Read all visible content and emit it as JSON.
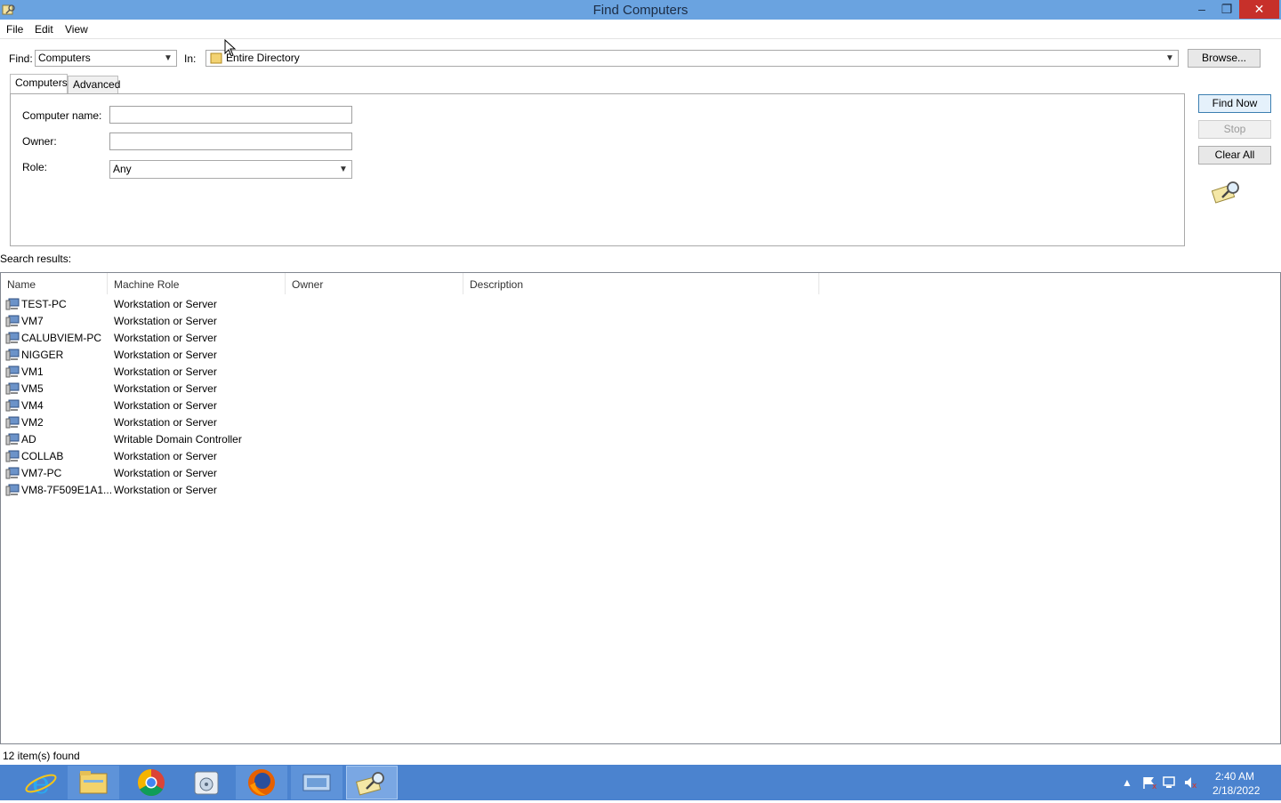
{
  "window": {
    "title": "Find Computers",
    "controls": {
      "minimize": "–",
      "maximize": "❐",
      "close": "✕"
    }
  },
  "menu": {
    "items": [
      "File",
      "Edit",
      "View"
    ]
  },
  "find": {
    "label": "Find:",
    "value": "Computers",
    "in_label": "In:",
    "in_value": "Entire Directory",
    "browse_label": "Browse..."
  },
  "tabs": [
    "Computers",
    "Advanced"
  ],
  "form": {
    "computer_name_label": "Computer name:",
    "computer_name_value": "",
    "owner_label": "Owner:",
    "owner_value": "",
    "role_label": "Role:",
    "role_value": "Any"
  },
  "actions": {
    "find_now": "Find Now",
    "stop": "Stop",
    "clear_all": "Clear All"
  },
  "results": {
    "label": "Search results:",
    "columns": [
      "Name",
      "Machine Role",
      "Owner",
      "Description"
    ],
    "rows": [
      {
        "name": "TEST-PC",
        "role": "Workstation or Server"
      },
      {
        "name": "VM7",
        "role": "Workstation or Server"
      },
      {
        "name": "CALUBVIEM-PC",
        "role": "Workstation or Server"
      },
      {
        "name": "NIGGER",
        "role": "Workstation or Server"
      },
      {
        "name": "VM1",
        "role": "Workstation or Server"
      },
      {
        "name": "VM5",
        "role": "Workstation or Server"
      },
      {
        "name": "VM4",
        "role": "Workstation or Server"
      },
      {
        "name": "VM2",
        "role": "Workstation or Server"
      },
      {
        "name": "AD",
        "role": "Writable Domain Controller"
      },
      {
        "name": "COLLAB",
        "role": "Workstation or Server"
      },
      {
        "name": "VM7-PC",
        "role": "Workstation or Server"
      },
      {
        "name": "VM8-7F509E1A1...",
        "role": "Workstation or Server"
      }
    ]
  },
  "status": {
    "text": "12 item(s) found"
  },
  "taskbar": {
    "apps": [
      "internet-explorer-icon",
      "file-explorer-icon",
      "chrome-icon",
      "media-app-icon",
      "firefox-icon",
      "remote-desktop-icon",
      "find-computers-icon"
    ],
    "clock_time": "2:40 AM",
    "clock_date": "2/18/2022"
  },
  "colors": {
    "titlebar": "#6aa3e0",
    "taskbar": "#4b83cf",
    "close": "#c7302a"
  }
}
